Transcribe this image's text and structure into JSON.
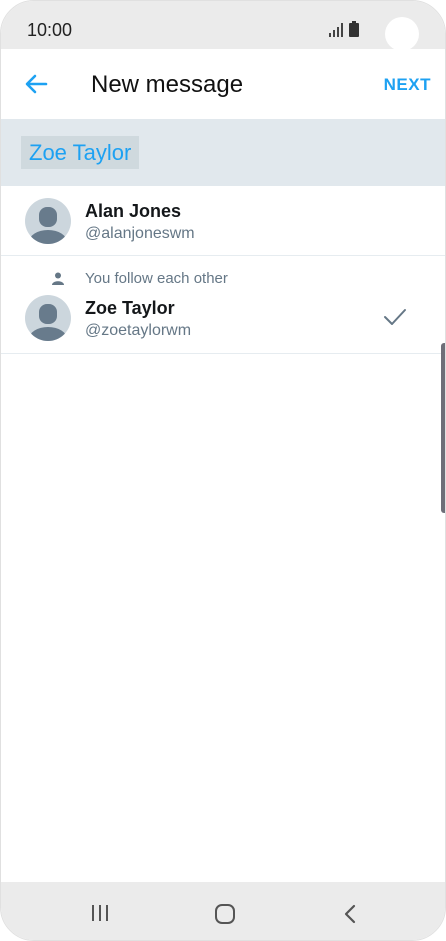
{
  "status_bar": {
    "time": "10:00"
  },
  "header": {
    "title": "New message",
    "next_label": "NEXT"
  },
  "recipients": [
    {
      "label": "Zoe Taylor"
    }
  ],
  "users": [
    {
      "name": "Alan Jones",
      "handle": "@alanjoneswm",
      "note": "",
      "selected": false
    },
    {
      "name": "Zoe Taylor",
      "handle": "@zoetaylorwm",
      "note": "You follow each other",
      "selected": true
    }
  ],
  "colors": {
    "accent": "#1da1f2",
    "recipient_bar": "#e1e8ed",
    "secondary_text": "#657786"
  },
  "icons": [
    "signal-icon",
    "battery-icon",
    "back-arrow-icon",
    "person-icon",
    "checkmark-icon",
    "recents-icon",
    "home-icon",
    "nav-back-icon"
  ]
}
